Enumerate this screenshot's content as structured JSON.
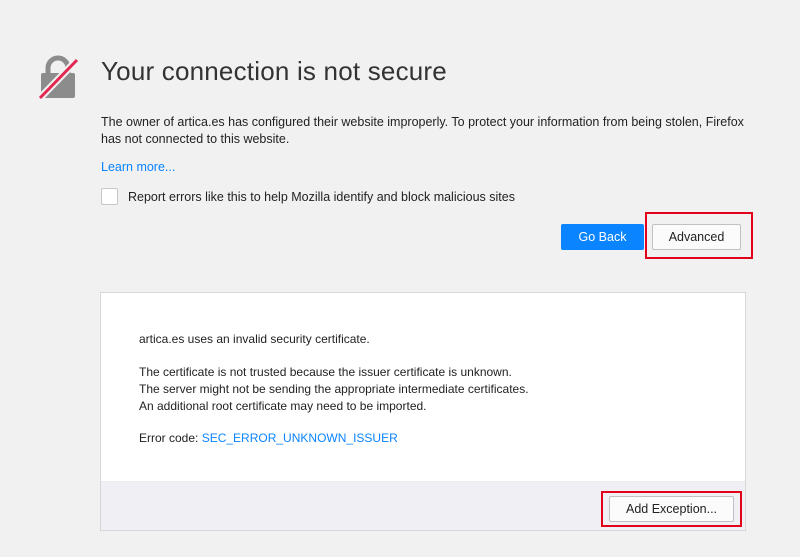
{
  "error_page": {
    "title": "Your connection is not secure",
    "description": "The owner of artica.es has configured their website improperly. To protect your information from being stolen, Firefox has not connected to this website.",
    "learn_more_label": "Learn more...",
    "report_checkbox_label": "Report errors like this to help Mozilla identify and block malicious sites",
    "report_checkbox_checked": false,
    "go_back_label": "Go Back",
    "advanced_label": "Advanced"
  },
  "advanced_panel": {
    "line_invalid": "artica.es uses an invalid security certificate.",
    "line_not_trusted": "The certificate is not trusted because the issuer certificate is unknown.",
    "line_server": "The server might not be sending the appropriate intermediate certificates.",
    "line_root": "An additional root certificate may need to be imported.",
    "error_code_prefix": "Error code: ",
    "error_code": "SEC_ERROR_UNKNOWN_ISSUER",
    "add_exception_label": "Add Exception..."
  },
  "icons": {
    "main": "broken-lock-icon"
  },
  "colors": {
    "background": "#f1f1f1",
    "accent_blue": "#0a84ff",
    "lock_gray": "#8c8c8c",
    "slash_red": "#e22850",
    "highlight_red": "#e3001b"
  }
}
